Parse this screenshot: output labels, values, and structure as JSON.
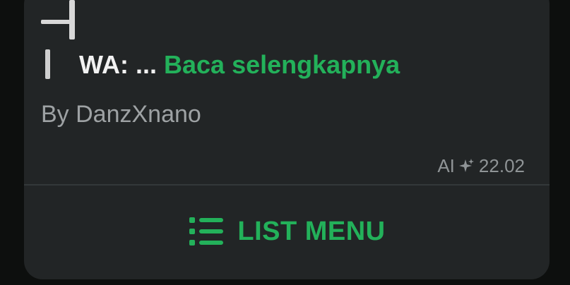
{
  "message": {
    "wa_label": "WA:",
    "ellipsis": " ... ",
    "read_more": "Baca selengkapnya",
    "author": "By DanzXnano",
    "ai_tag": "AI",
    "time": "22.02"
  },
  "action": {
    "button_label": "LIST MENU",
    "icon": "list-icon"
  },
  "colors": {
    "bubble": "#222526",
    "accent": "#23b15a",
    "muted_text": "#9ea2a4",
    "background": "#0d0f0e"
  }
}
